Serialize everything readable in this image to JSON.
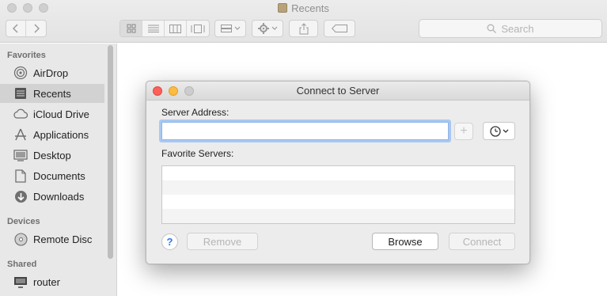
{
  "window": {
    "title": "Recents"
  },
  "toolbar": {
    "search_placeholder": "Search",
    "back_icon": "chevron-left-icon",
    "forward_icon": "chevron-right-icon"
  },
  "sidebar": {
    "favorites_header": "Favorites",
    "favorites": [
      {
        "label": "AirDrop",
        "icon": "airdrop-icon"
      },
      {
        "label": "Recents",
        "icon": "recents-icon",
        "selected": true
      },
      {
        "label": "iCloud Drive",
        "icon": "cloud-icon"
      },
      {
        "label": "Applications",
        "icon": "applications-icon"
      },
      {
        "label": "Desktop",
        "icon": "desktop-icon"
      },
      {
        "label": "Documents",
        "icon": "document-icon"
      },
      {
        "label": "Downloads",
        "icon": "download-icon"
      }
    ],
    "devices_header": "Devices",
    "devices": [
      {
        "label": "Remote Disc",
        "icon": "disc-icon"
      }
    ],
    "shared_header": "Shared",
    "shared": [
      {
        "label": "router",
        "icon": "monitor-icon"
      }
    ]
  },
  "dialog": {
    "title": "Connect to Server",
    "server_address_label": "Server Address:",
    "server_address_value": "",
    "favorite_servers_label": "Favorite Servers:",
    "favorite_servers": [],
    "remove_label": "Remove",
    "browse_label": "Browse",
    "connect_label": "Connect",
    "help_label": "?",
    "add_label": "+"
  },
  "colors": {
    "close": "#fc605b",
    "minimize": "#fdbc40",
    "zoom": "#c8c8c8",
    "focus_ring": "#a9c8f2",
    "help_blue": "#2f7ae5"
  }
}
